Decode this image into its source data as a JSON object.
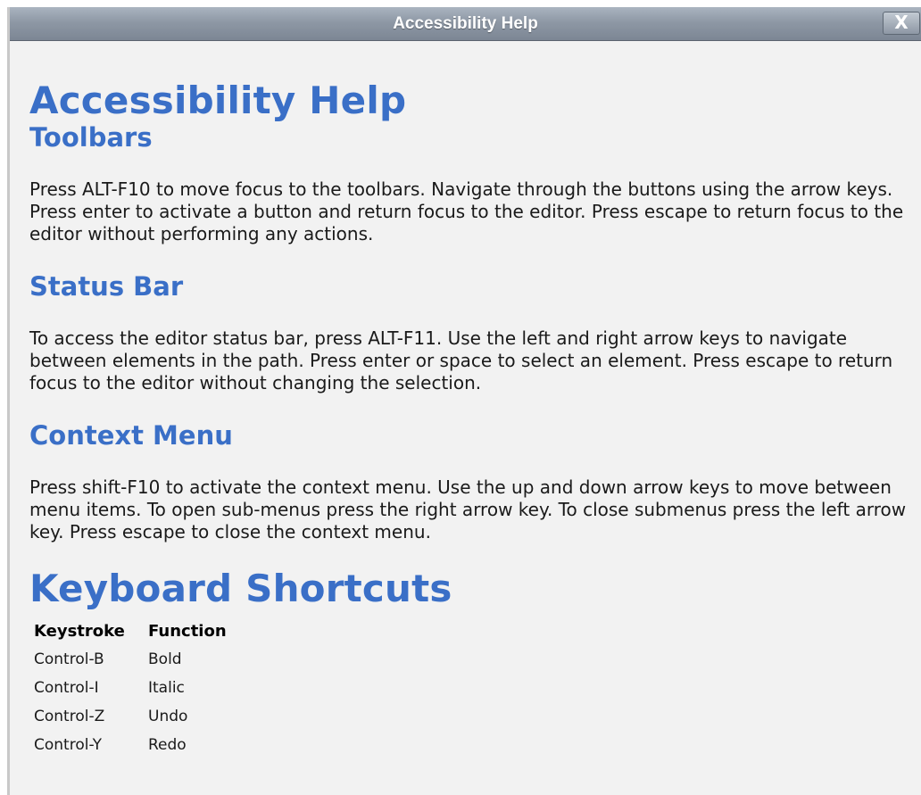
{
  "window": {
    "title": "Accessibility Help",
    "close_label": "X"
  },
  "content": {
    "main_heading": "Accessibility Help",
    "sections": [
      {
        "heading": "Toolbars",
        "text": "Press ALT-F10 to move focus to the toolbars. Navigate through the buttons using the arrow keys. Press enter to activate a button and return focus to the editor. Press escape to return focus to the editor without performing any actions."
      },
      {
        "heading": "Status Bar",
        "text": "To access the editor status bar, press ALT-F11. Use the left and right arrow keys to navigate between elements in the path. Press enter or space to select an element. Press escape to return focus to the editor without changing the selection."
      },
      {
        "heading": "Context Menu",
        "text": "Press shift-F10 to activate the context menu. Use the up and down arrow keys to move between menu items. To open sub-menus press the right arrow key. To close submenus press the left arrow key. Press escape to close the context menu."
      }
    ],
    "shortcuts_heading": "Keyboard Shortcuts",
    "shortcuts_table": {
      "headers": [
        "Keystroke",
        "Function"
      ],
      "rows": [
        [
          "Control-B",
          "Bold"
        ],
        [
          "Control-I",
          "Italic"
        ],
        [
          "Control-Z",
          "Undo"
        ],
        [
          "Control-Y",
          "Redo"
        ]
      ]
    }
  },
  "colors": {
    "heading": "#3a6fc7",
    "titlebar": "#8e98a5",
    "background": "#f2f2f2"
  }
}
